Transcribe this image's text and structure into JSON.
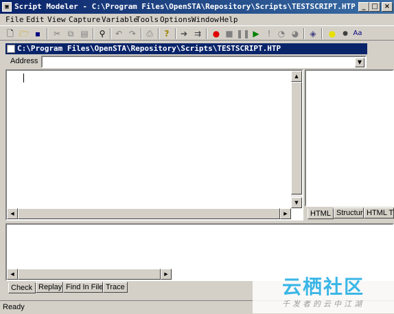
{
  "window": {
    "title": "Script Modeler - C:\\Program Files\\OpenSTA\\Repository\\Scripts\\TESTSCRIPT.HTP",
    "minimize": "_",
    "maximize": "□",
    "close": "×"
  },
  "menu": [
    "File",
    "Edit",
    "View",
    "Capture",
    "Variable",
    "Tools",
    "Options",
    "Window",
    "Help"
  ],
  "document": {
    "title": "C:\\Program Files\\OpenSTA\\Repository\\Scripts\\TESTSCRIPT.HTP"
  },
  "address": {
    "label": "Address",
    "value": ""
  },
  "right_tabs": [
    "HTML",
    "Structure",
    "HTML T"
  ],
  "bottom_tabs": [
    "Check",
    "Replay",
    "Find In Files",
    "Trace"
  ],
  "status": "Ready",
  "watermark": {
    "logo": "云栖社区",
    "tagline": "千发者的云中江湖"
  },
  "colors": {
    "title_active": "#0a246a",
    "record": "#e00000",
    "play": "#008000"
  }
}
